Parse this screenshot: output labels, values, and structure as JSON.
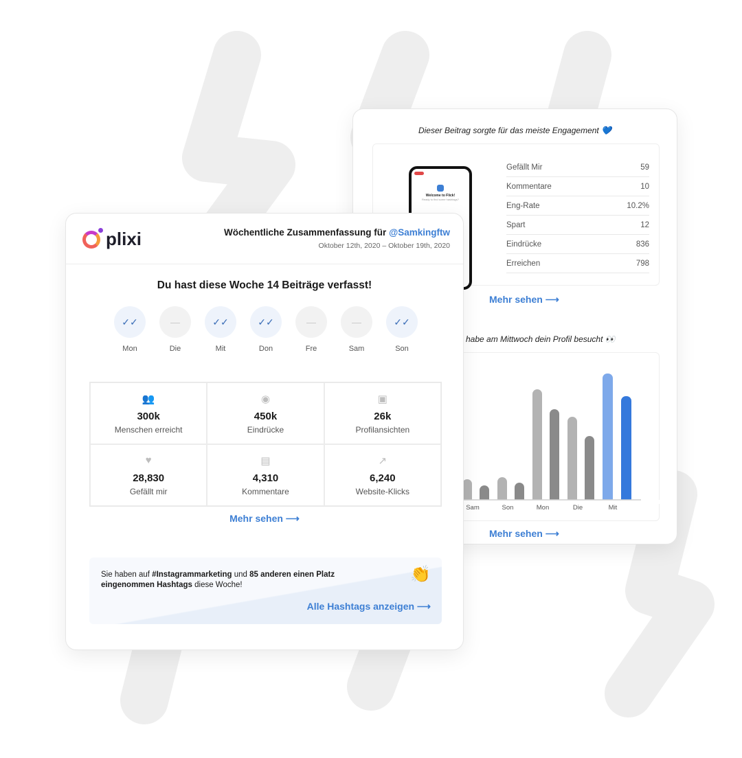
{
  "back_card": {
    "top_post_title": "Dieser Beitrag sorgte für das meiste Engagement 💙",
    "phone_preview": {
      "heading": "Welcome to Flick!",
      "sub": "Ready to find some hashtags?"
    },
    "post_stats": [
      {
        "label": "Gefällt Mir",
        "value": "59"
      },
      {
        "label": "Kommentare",
        "value": "10"
      },
      {
        "label": "Eng-Rate",
        "value": "10.2%"
      },
      {
        "label": "Spart",
        "value": "12"
      },
      {
        "label": "Eindrücke",
        "value": "836"
      },
      {
        "label": "Erreichen",
        "value": "798"
      }
    ],
    "more_link_1": "Mehr sehen ⟶",
    "profile_visits_title": "habe am Mittwoch dein Profil besucht 👀",
    "more_link_2": "Mehr sehen ⟶"
  },
  "chart_data": {
    "type": "bar",
    "categories": [
      "Sam",
      "Son",
      "Mon",
      "Die",
      "Mit"
    ],
    "series": [
      {
        "values": [
          30,
          33,
          161,
          121,
          184
        ]
      },
      {
        "values": [
          21,
          25,
          132,
          93,
          151
        ]
      }
    ],
    "highlight_category": "Mit",
    "colors": {
      "series1": "#b3b3b3",
      "series2": "#8a8a8a",
      "highlight1": "#7ea9ea",
      "highlight2": "#3579dc"
    },
    "grid": false
  },
  "front_card": {
    "logo": "plixi",
    "title": "Wöchentliche Zusammenfassung für",
    "handle": "@Samkingftw",
    "date_range": "Oktober 12th, 2020 – Oktober 19th, 2020",
    "posts_headline": "Du hast diese Woche 14 Beiträge verfasst!",
    "days": [
      {
        "label": "Mon",
        "posted": true,
        "icon": "✓✓"
      },
      {
        "label": "Die",
        "posted": false,
        "icon": "—"
      },
      {
        "label": "Mit",
        "posted": true,
        "icon": "✓✓"
      },
      {
        "label": "Don",
        "posted": true,
        "icon": "✓✓"
      },
      {
        "label": "Fre",
        "posted": false,
        "icon": "—"
      },
      {
        "label": "Sam",
        "posted": false,
        "icon": "—"
      },
      {
        "label": "Son",
        "posted": true,
        "icon": "✓✓"
      }
    ],
    "metrics": [
      {
        "icon": "people-icon",
        "glyph": "👥",
        "value": "300k",
        "label": "Menschen erreicht"
      },
      {
        "icon": "eye-icon",
        "glyph": "◉",
        "value": "450k",
        "label": "Eindrücke"
      },
      {
        "icon": "profile-icon",
        "glyph": "▣",
        "value": "26k",
        "label": "Profilansichten"
      },
      {
        "icon": "heart-icon",
        "glyph": "♥",
        "value": "28,830",
        "label": "Gefällt mir"
      },
      {
        "icon": "comment-icon",
        "glyph": "▤",
        "value": "4,310",
        "label": "Kommentare"
      },
      {
        "icon": "arrow-up-right-icon",
        "glyph": "↗",
        "value": "6,240",
        "label": "Website-Klicks"
      }
    ],
    "more_link": "Mehr sehen ⟶",
    "hashtag_text_1": "Sie haben auf ",
    "hashtag_tag": "#Instagrammarketing",
    "hashtag_text_2": " und ",
    "hashtag_text_3": "85 anderen einen Platz eingenommen Hashtags",
    "hashtag_text_4": " diese Woche!",
    "hashtag_emoji": "👏",
    "hashtag_link": "Alle Hashtags anzeigen ⟶"
  },
  "accent": "#3d7fd4"
}
